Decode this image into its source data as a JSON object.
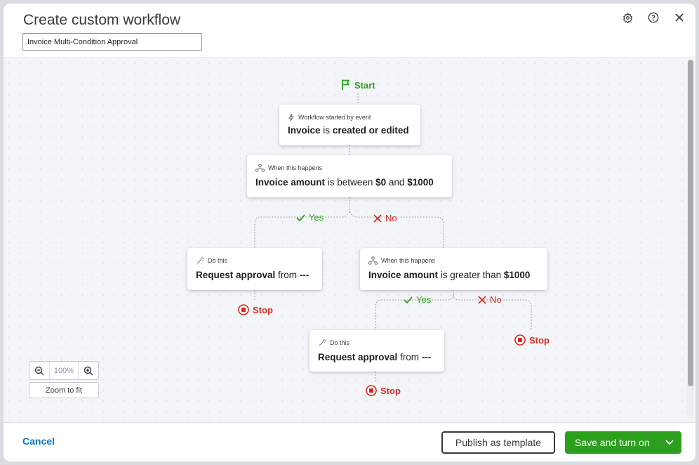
{
  "header": {
    "title": "Create custom workflow",
    "workflow_name": "Invoice Multi-Condition Approval"
  },
  "flow": {
    "start_label": "Start",
    "trigger": {
      "head": "Workflow started by event",
      "subject": "Invoice",
      "verb": "is",
      "event": "created or edited"
    },
    "condition1": {
      "head": "When this happens",
      "field": "Invoice amount",
      "operator": "is between",
      "low": "$0",
      "and": "and",
      "high": "$1000"
    },
    "yes1": "Yes",
    "no1": "No",
    "action1": {
      "head": "Do this",
      "verb": "Request approval",
      "from": "from",
      "who": "---"
    },
    "stop1": "Stop",
    "condition2": {
      "head": "When this happens",
      "field": "Invoice amount",
      "operator": "is greater than",
      "value": "$1000"
    },
    "yes2": "Yes",
    "no2": "No",
    "stop2": "Stop",
    "action2": {
      "head": "Do this",
      "verb": "Request approval",
      "from": "from",
      "who": "---"
    },
    "stop3": "Stop"
  },
  "zoom": {
    "level": "100%",
    "fit_label": "Zoom to fit"
  },
  "footer": {
    "cancel": "Cancel",
    "publish": "Publish as template",
    "save": "Save and turn on"
  },
  "colors": {
    "green": "#2ca01c",
    "red": "#d52b1e",
    "link": "#0077c5"
  },
  "icons": {
    "settings": "gear-icon",
    "help": "question-circle-icon",
    "close": "close-icon"
  }
}
